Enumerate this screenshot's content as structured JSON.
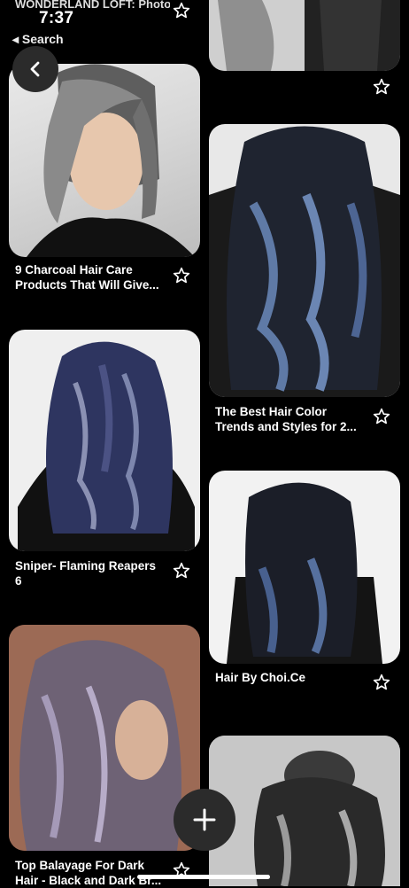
{
  "status_bar": {
    "time": "7:37"
  },
  "nav": {
    "back_label": "◂ Search",
    "previous_title": "WONDERLAND LOFT: Photo"
  },
  "pins": [
    {
      "caption_line1": "9 Charcoal Hair Care",
      "caption_line2": "Products That Will Give..."
    },
    {
      "caption_line1": "Sniper- Flaming Reapers",
      "caption_line2": "6"
    },
    {
      "caption_line1": "Top Balayage For Dark",
      "caption_line2": "Hair - Black and Dark Br..."
    },
    {
      "caption_line1": "",
      "caption_line2": ""
    },
    {
      "caption_line1": "The Best Hair Color",
      "caption_line2": "Trends and Styles for 2..."
    },
    {
      "caption_line1": "Hair By Choi.Ce",
      "caption_line2": ""
    },
    {
      "caption_line1": "",
      "caption_line2": ""
    }
  ],
  "colors": {
    "background": "#000000",
    "button": "#2b2b2b",
    "text": "#ffffff"
  },
  "icons": [
    "back-arrow-icon",
    "plus-icon",
    "star-outline-icon",
    "signal-icon",
    "wifi-icon",
    "battery-icon"
  ]
}
